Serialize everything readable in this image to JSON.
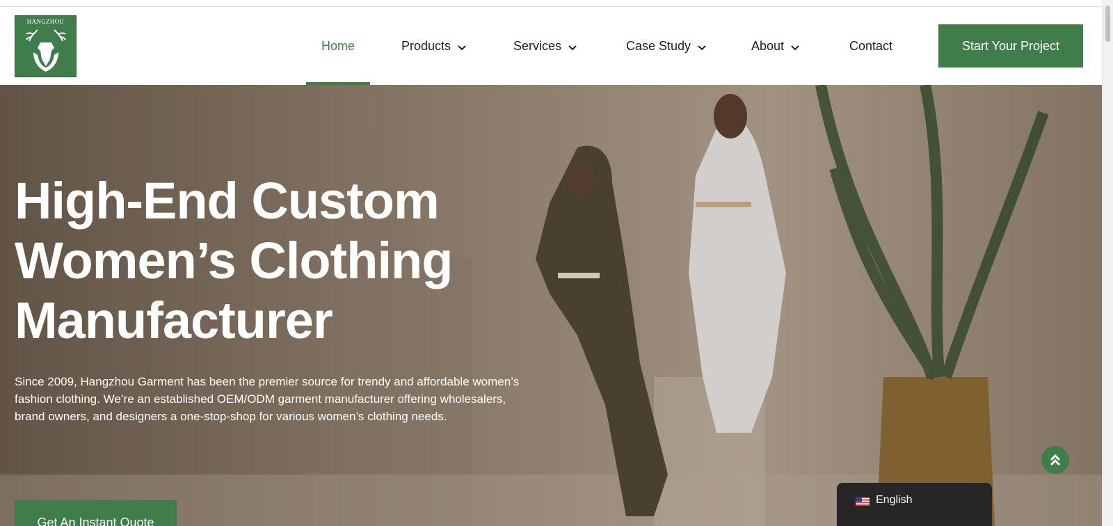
{
  "header": {
    "logo_text": "HANGZHOU",
    "nav": [
      {
        "label": "Home",
        "has_dropdown": false,
        "active": true
      },
      {
        "label": "Products",
        "has_dropdown": true,
        "active": false
      },
      {
        "label": "Services",
        "has_dropdown": true,
        "active": false
      },
      {
        "label": "Case Study",
        "has_dropdown": true,
        "active": false
      },
      {
        "label": "About",
        "has_dropdown": true,
        "active": false
      },
      {
        "label": "Contact",
        "has_dropdown": false,
        "active": false
      }
    ],
    "cta_label": "Start Your Project"
  },
  "hero": {
    "title_lines": [
      "High-End Custom",
      "Women’s Clothing",
      "Manufacturer"
    ],
    "description": "Since 2009, Hangzhou Garment has been the premier source for trendy and affordable women’s fashion clothing. We’re an established OEM/ODM garment manufacturer offering wholesalers, brand owners, and designers a one-stop-shop for various women’s clothing needs.",
    "quote_button": "Get An Instant Quote"
  },
  "language_switcher": {
    "flag_icon": "us-flag-icon",
    "label": "English"
  },
  "back_to_top_icon": "double-chevron-up-icon",
  "colors": {
    "brand_green": "#3f7d4a",
    "nav_text": "#1e1e1e",
    "lang_bg": "#262626"
  }
}
